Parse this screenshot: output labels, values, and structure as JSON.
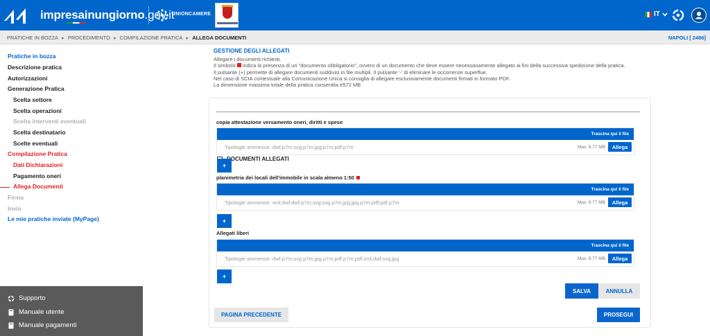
{
  "header": {
    "brand_bold": "impresainungiorno",
    "brand_thin": ".gov.it",
    "unioncamere": "UNIONCAMERE",
    "language": "IT",
    "icons": [
      "app-logo-icon",
      "unioncamere-icon",
      "chevron-down-icon",
      "support-icon",
      "user-icon"
    ]
  },
  "breadcrumb": {
    "items": [
      "PRATICHE IN BOZZA",
      "PROCEDIMENTO",
      "COMPILAZIONE PRATICA",
      "ALLEGA DOCUMENTI"
    ],
    "separator": "▸",
    "location": "NAPOLI [ 2486]"
  },
  "sidebar": {
    "items": [
      {
        "label": "Pratiche in bozza",
        "level": 1,
        "state": "link"
      },
      {
        "label": "Descrizione pratica",
        "level": 1,
        "state": "done"
      },
      {
        "label": "Autorizzazioni",
        "level": 1,
        "state": "done"
      },
      {
        "label": "Generazione Pratica",
        "level": 1,
        "state": "done"
      },
      {
        "label": "Scelta settore",
        "level": 2,
        "state": "done"
      },
      {
        "label": "Scelta operazioni",
        "level": 2,
        "state": "done"
      },
      {
        "label": "Scelta interventi eventuali",
        "level": 2,
        "state": "disabled"
      },
      {
        "label": "Scelta destinatario",
        "level": 2,
        "state": "done"
      },
      {
        "label": "Scelte eventuali",
        "level": 2,
        "state": "done"
      },
      {
        "label": "Compilazione Pratica",
        "level": 1,
        "state": "current"
      },
      {
        "label": "Dati Dichiarazioni",
        "level": 2,
        "state": "current"
      },
      {
        "label": "Pagamento oneri",
        "level": 2,
        "state": "done"
      },
      {
        "label": "Allega Documenti",
        "level": 2,
        "state": "current"
      },
      {
        "label": "Firma",
        "level": 1,
        "state": "disabled"
      },
      {
        "label": "Invio",
        "level": 1,
        "state": "disabled"
      },
      {
        "label": "Le mie pratiche inviate (MyPage)",
        "level": 1,
        "state": "link"
      }
    ],
    "footer": [
      {
        "label": "Supporto",
        "icon": "support-icon"
      },
      {
        "label": "Manuale utente",
        "icon": "book-icon"
      },
      {
        "label": "Manuale pagamenti",
        "icon": "book-icon"
      }
    ]
  },
  "main": {
    "section_title": "GESTIONE DEGLI ALLEGATI",
    "intro": {
      "line1": "Allegare i documenti richiesti.",
      "line2_a": "Il simbolo",
      "line2_b": "indica la presenza di un \"documento obbligatorio\", ovvero di un documento che deve essere necessariamente allegato ai fini della successiva spedizione della pratica.",
      "line3": "Il pulsante (+) permette di allegare documenti suddivisi in file multipli. Il pulsante '-' di eliminare le occorrenze superflue.",
      "line4": "Nel caso di SCIA contestuale alla Comunicazione Unica si consiglia di allegare esclusivamente documenti firmati in formato PDF.",
      "line5": "La dimensione massima totale della pratica consentita è572 MB"
    },
    "documents_header": "DOCUMENTI ALLEGATI",
    "groups": [
      {
        "label": "copia attestazione versamento oneri, diritti e spese",
        "required": false,
        "drop_label": "Trascina qui il file",
        "types": "Tipologie ammesse: dwf;p7m;svg;p7m;jpg;p7m;pdf;p7m",
        "max": "Max: 9,77 MB",
        "upload_label": "Allega",
        "add_label": "+"
      },
      {
        "label": "planimetria dei locali dell'immobile in scala almeno 1:50",
        "required": true,
        "drop_label": "Trascina qui il file",
        "types": "Tipologie ammesse: xml;dwf;dwf.p7m;svg;svg.p7m;jpg;jpg.p7m;pdf;pdf.p7m",
        "max": "Max: 9,77 MB",
        "upload_label": "Allega",
        "add_label": "+"
      },
      {
        "label": "Allegati liberi",
        "required": false,
        "drop_label": "Trascina qui il file",
        "types": "Tipologie ammesse: dwf.p7m;svg.p7m;jpg.p7m;pdf.p7m;pdf;xml;dwf;svg;jpg",
        "max": "Max: 9,77 MB",
        "upload_label": "Allega",
        "add_label": "+"
      }
    ],
    "buttons": {
      "save": "SALVA",
      "cancel": "ANNULLA",
      "previous": "PAGINA PRECEDENTE",
      "next": "PROSEGUI"
    }
  },
  "colors": {
    "primary": "#0066cc",
    "required": "#e02020",
    "sidebar_footer": "#5a5a5a"
  }
}
